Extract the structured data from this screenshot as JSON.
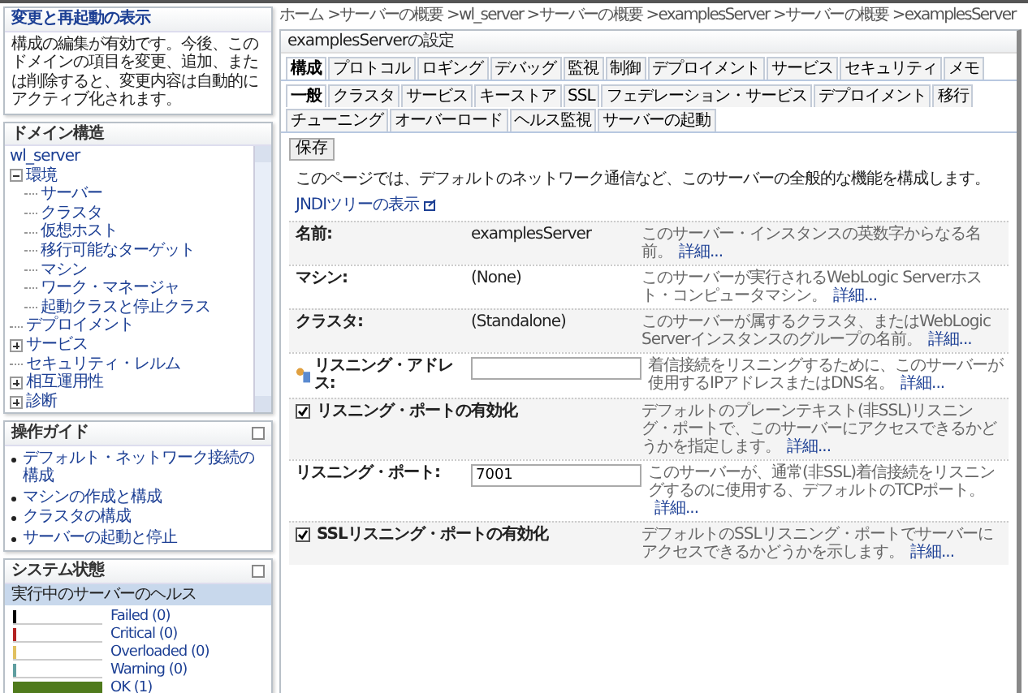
{
  "change_center": {
    "title": "変更と再起動の表示",
    "text": "構成の編集が有効です。今後、このドメインの項目を変更、追加、または削除すると、変更内容は自動的にアクティブ化されます。"
  },
  "domain_structure": {
    "title": "ドメイン構造",
    "tree": [
      {
        "label": "wl_server",
        "kind": "root",
        "children": [
          {
            "label": "環境",
            "expanded": true,
            "children": [
              {
                "label": "サーバー"
              },
              {
                "label": "クラスタ"
              },
              {
                "label": "仮想ホスト"
              },
              {
                "label": "移行可能なターゲット"
              },
              {
                "label": "マシン"
              },
              {
                "label": "ワーク・マネージャ"
              },
              {
                "label": "起動クラスと停止クラス"
              }
            ]
          },
          {
            "label": "デプロイメント"
          },
          {
            "label": "サービス",
            "expanded": false
          },
          {
            "label": "セキュリティ・レルム"
          },
          {
            "label": "相互運用性",
            "expanded": false
          },
          {
            "label": "診断",
            "expanded": false
          }
        ]
      }
    ]
  },
  "how_do_i": {
    "title": "操作ガイド",
    "items": [
      "デフォルト・ネットワーク接続の構成",
      "マシンの作成と構成",
      "クラスタの構成",
      "サーバーの起動と停止"
    ]
  },
  "system_status": {
    "title": "システム状態",
    "subtitle": "実行中のサーバーのヘルス",
    "items": [
      {
        "label": "Failed (0)",
        "color": "#000000",
        "level": 0
      },
      {
        "label": "Critical (0)",
        "color": "#b22222",
        "level": 0
      },
      {
        "label": "Overloaded (0)",
        "color": "#e0c060",
        "level": 0
      },
      {
        "label": "Warning (0)",
        "color": "#5f9ea0",
        "level": 0
      },
      {
        "label": "OK (1)",
        "color": "#4f7a1c",
        "level": 1
      }
    ]
  },
  "breadcrumb": "ホーム >サーバーの概要 >wl_server >サーバーの概要 >examplesServer >サーバーの概要 >examplesServer",
  "settings": {
    "title": "examplesServerの設定",
    "tabs": [
      {
        "label": "構成",
        "selected": true
      },
      {
        "label": "プロトコル",
        "selected": false
      },
      {
        "label": "ロギング",
        "selected": false
      },
      {
        "label": "デバッグ",
        "selected": false
      },
      {
        "label": "監視",
        "selected": false
      },
      {
        "label": "制御",
        "selected": false
      },
      {
        "label": "デプロイメント",
        "selected": false
      },
      {
        "label": "サービス",
        "selected": false
      },
      {
        "label": "セキュリティ",
        "selected": false
      },
      {
        "label": "メモ",
        "selected": false
      }
    ],
    "subtabs": [
      {
        "label": "一般",
        "selected": true
      },
      {
        "label": "クラスタ",
        "selected": false
      },
      {
        "label": "サービス",
        "selected": false
      },
      {
        "label": "キーストア",
        "selected": false
      },
      {
        "label": "SSL",
        "selected": false
      },
      {
        "label": "フェデレーション・サービス",
        "selected": false
      },
      {
        "label": "デプロイメント",
        "selected": false
      },
      {
        "label": "移行",
        "selected": false
      },
      {
        "label": "チューニング",
        "selected": false
      },
      {
        "label": "オーバーロード",
        "selected": false
      },
      {
        "label": "ヘルス監視",
        "selected": false
      },
      {
        "label": "サーバーの起動",
        "selected": false
      }
    ],
    "save_button": "保存",
    "intro": "このページでは、デフォルトのネットワーク通信など、このサーバーの全般的な機能を構成します。",
    "jndi_link": "JNDIツリーの表示",
    "rows": [
      {
        "kind": "text",
        "label": "名前:",
        "value": "examplesServer",
        "help": "このサーバー・インスタンスの英数字からなる名前。",
        "more": "詳細..."
      },
      {
        "kind": "text",
        "label": "マシン:",
        "value": "(None)",
        "help": "このサーバーが実行されるWebLogic Serverホスト・コンピュータマシン。",
        "more": "詳細..."
      },
      {
        "kind": "text",
        "label": "クラスタ:",
        "value": "(Standalone)",
        "help": "このサーバーが属するクラスタ、またはWebLogic Serverインスタンスのグループの名前。",
        "more": "詳細..."
      },
      {
        "kind": "input",
        "label": "リスニング・アドレス:",
        "value": "",
        "help": "着信接続をリスニングするために、このサーバーが使用するIPアドレスまたはDNS名。",
        "more": "詳細..."
      },
      {
        "kind": "checkbox",
        "label": "リスニング・ポートの有効化",
        "checked": true,
        "help": "デフォルトのプレーンテキスト(非SSL)リスニング・ポートで、このサーバーにアクセスできるかどうかを指定します。",
        "more": "詳細..."
      },
      {
        "kind": "input",
        "label": "リスニング・ポート:",
        "value": "7001",
        "help": "このサーバーが、通常(非SSL)着信接続をリスニングするのに使用する、デフォルトのTCPポート。",
        "more": "詳細..."
      },
      {
        "kind": "checkbox",
        "label": "SSLリスニング・ポートの有効化",
        "checked": true,
        "help": "デフォルトのSSLリスニング・ポートでサーバーにアクセスできるかどうかを示します。",
        "more": "詳細..."
      }
    ]
  }
}
